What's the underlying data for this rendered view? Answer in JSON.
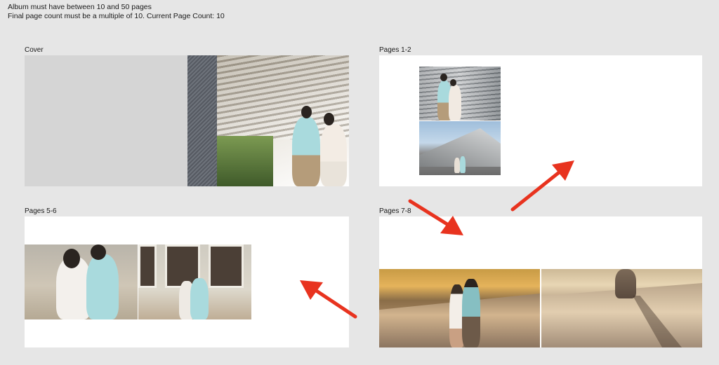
{
  "messages": {
    "line1": "Album must have between 10 and 50 pages",
    "line2": "Final page count must be a multiple of 10. Current Page Count: 10"
  },
  "spreads": {
    "cover": {
      "label": "Cover"
    },
    "pages_1_2": {
      "label": "Pages 1-2"
    },
    "pages_5_6": {
      "label": "Pages 5-6"
    },
    "pages_7_8": {
      "label": "Pages 7-8"
    }
  },
  "colors": {
    "background": "#e6e6e6",
    "spread": "#ffffff",
    "cover_left": "#d5d5d5",
    "arrow": "#e8331f"
  },
  "annotations": {
    "arrow_icon": "red-arrow-icon"
  }
}
